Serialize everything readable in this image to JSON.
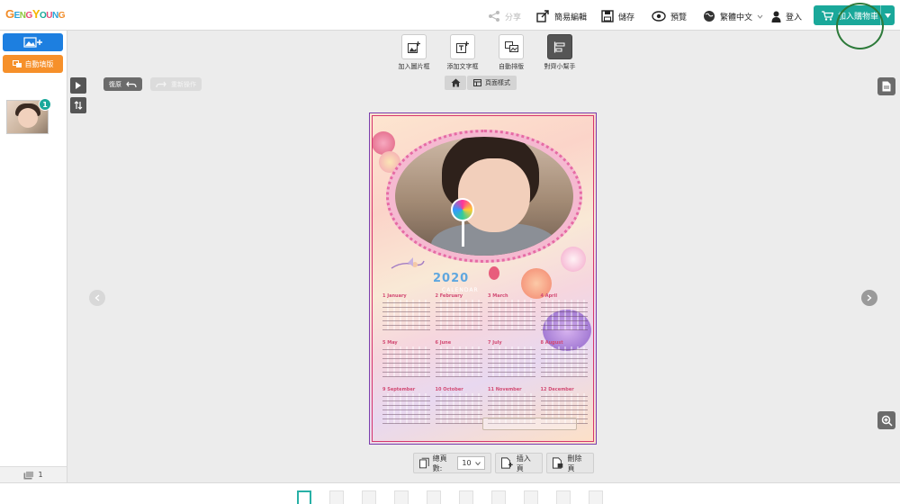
{
  "brand": {
    "logo_text": "GENGYOUNG",
    "logo_colors": [
      "#f28c28",
      "#2aa3d8",
      "#8cc63f",
      "#e84a76",
      "#f7b500",
      "#1aa89a",
      "#e84a76",
      "#2aa3d8",
      "#f28c28"
    ]
  },
  "header": {
    "share_label": "分享",
    "editor_label": "簡易編輯",
    "save_label": "儲存",
    "preview_label": "預覽",
    "language_label": "繁體中文",
    "login_label": "登入",
    "cart_label": "加入購物車"
  },
  "sidebar": {
    "add_photo_icon": "add-photo-icon",
    "auto_fill_label": "自動填版",
    "photo_count_badge": "1",
    "footer_count": "1"
  },
  "toolbar": {
    "items": [
      {
        "label": "加入圖片框",
        "icon": "add-image-frame-icon"
      },
      {
        "label": "添加文字框",
        "icon": "add-text-frame-icon"
      },
      {
        "label": "自動排版",
        "icon": "auto-layout-icon"
      },
      {
        "label": "對齊小幫手",
        "icon": "align-helper-icon"
      }
    ]
  },
  "canvas_controls": {
    "undo_label": "復原",
    "redo_label": "重新操作",
    "page_style_label": "頁面樣式"
  },
  "design": {
    "year": "2020",
    "subtitle": "CALENDAR",
    "months": [
      "1 January",
      "2 February",
      "3 March",
      "4 April",
      "5 May",
      "6 June",
      "7 July",
      "8 August",
      "9 September",
      "10 October",
      "11 November",
      "12 December"
    ]
  },
  "page_bar": {
    "total_pages_label": "總頁數:",
    "total_pages_value": "10",
    "insert_page_label": "插入頁",
    "delete_page_label": "刪除頁"
  },
  "page_strip": {
    "active_index": 0,
    "count": 10
  },
  "colors": {
    "accent": "#1aa89a",
    "blue": "#1d7fe0",
    "orange": "#f6902a",
    "ring": "#2d7a3a"
  }
}
